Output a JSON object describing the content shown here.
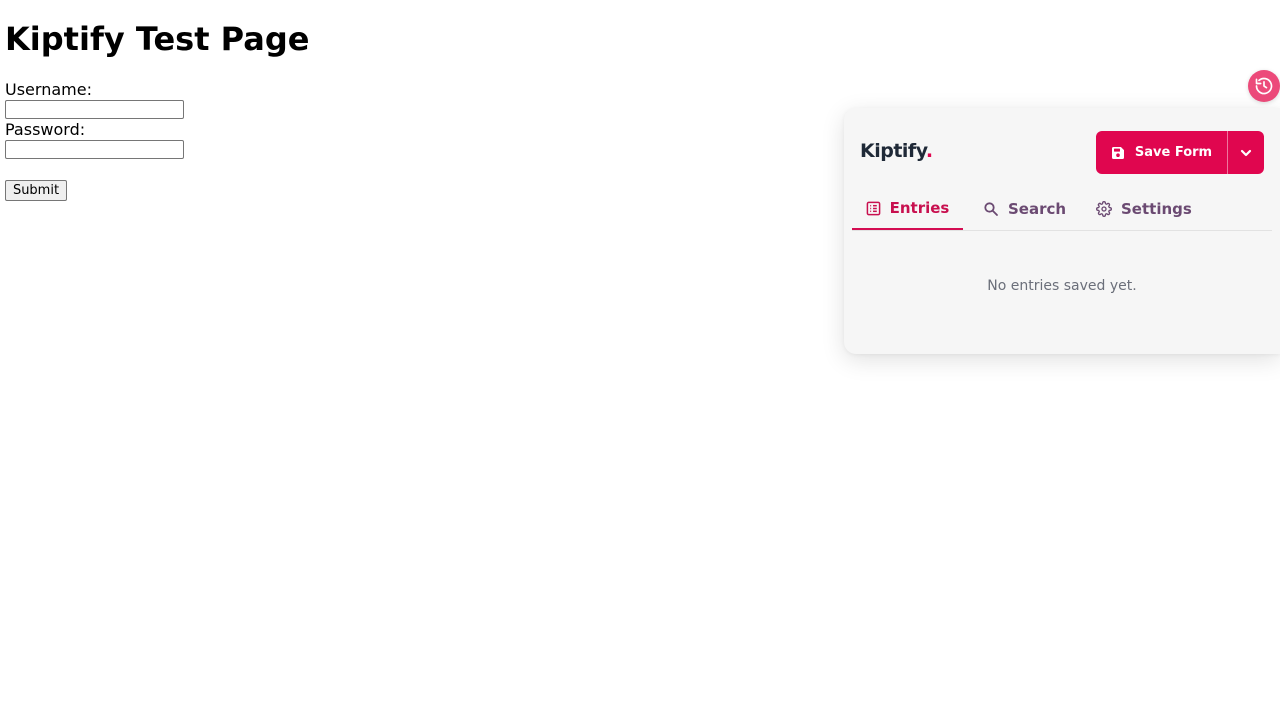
{
  "page": {
    "title": "Kiptify Test Page",
    "username_label": "Username:",
    "username_value": "",
    "password_label": "Password:",
    "password_value": "",
    "submit_label": "Submit"
  },
  "history_button": {
    "icon": "history-icon"
  },
  "panel": {
    "brand": "Kiptify",
    "brand_dot": ".",
    "save_button": {
      "label": "Save Form",
      "icon": "floppy-disk-icon",
      "dropdown_icon": "chevron-down-icon"
    },
    "tabs": [
      {
        "label": "Entries",
        "icon": "list-icon",
        "active": true
      },
      {
        "label": "Search",
        "icon": "search-icon",
        "active": false
      },
      {
        "label": "Settings",
        "icon": "gear-icon",
        "active": false
      }
    ],
    "empty_message": "No entries saved yet."
  },
  "colors": {
    "accent": "#e0064f",
    "history_button": "#ec4a7a",
    "tab_inactive": "#6b4a72",
    "panel_background": "#f6f6f6"
  }
}
